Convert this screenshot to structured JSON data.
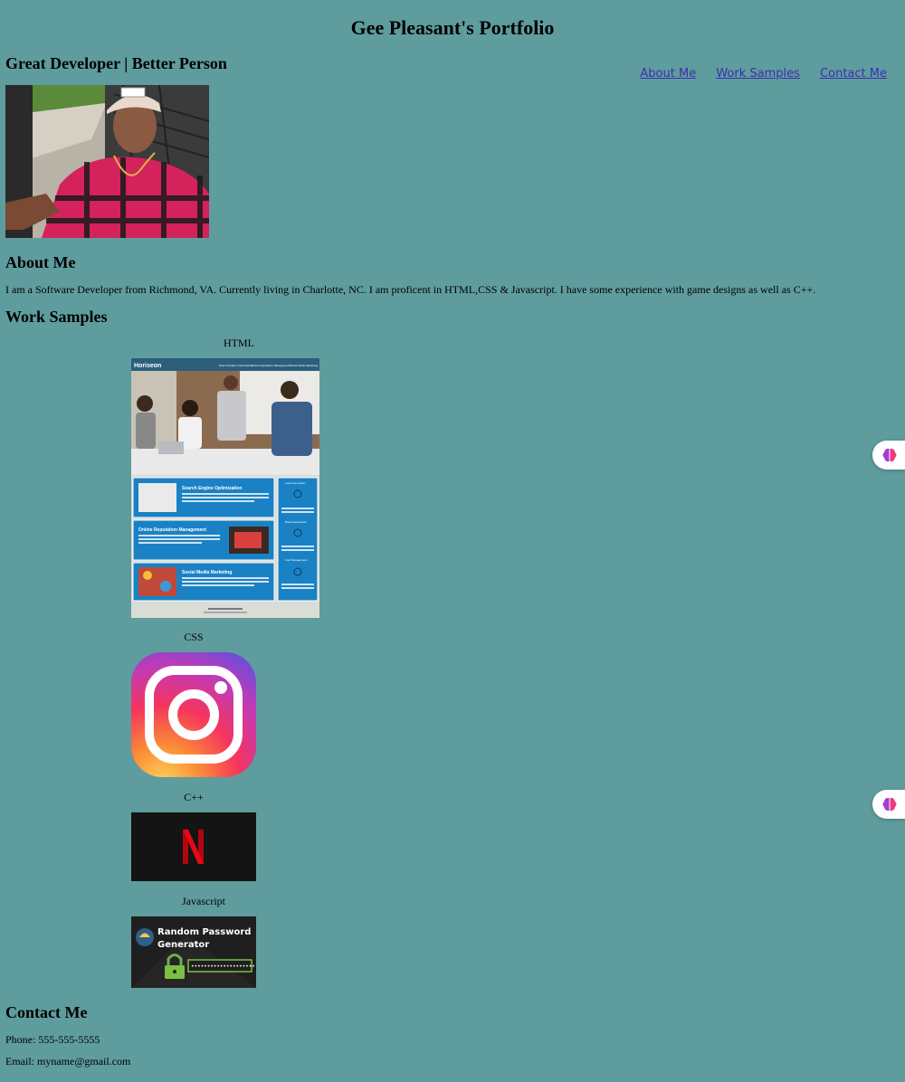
{
  "header": {
    "title": "Gee Pleasant's Portfolio",
    "tagline": "Great Developer | Better Person"
  },
  "nav": {
    "items": [
      "About Me",
      "Work Samples",
      "Contact Me"
    ]
  },
  "about": {
    "heading": "About Me",
    "text": "I am a Software Developer from Richmond, VA. Currently living in Charlotte, NC. I am proficent in HTML,CSS & Javascript. I have some experience with game designs as well as C++."
  },
  "work": {
    "heading": "Work Samples",
    "samples": [
      {
        "label": "HTML",
        "site_name": "Horiseon",
        "nav_links": [
          "Search Engine Optimization",
          "Online Reputation Management",
          "Social Media Marketing"
        ],
        "cards": [
          "Search Engine Optimization",
          "Online Reputation Management",
          "Social Media Marketing"
        ],
        "sidebar": [
          "Lead Generation",
          "Brand Awareness",
          "Cost Management"
        ]
      },
      {
        "label": "CSS",
        "icon": "instagram-icon"
      },
      {
        "label": "C++",
        "icon": "netflix-icon",
        "logo_letter": "N"
      },
      {
        "label": "Javascript",
        "title_line1": "Random Password",
        "title_line2": "Generator",
        "password": "••••••••••••••••••••"
      }
    ]
  },
  "contact": {
    "heading": "Contact Me",
    "phone": "Phone: 555-555-5555",
    "email": "Email: myname@gmail.com"
  },
  "colors": {
    "background": "#5f9c9e",
    "link": "#3b2fb0",
    "netflix_red": "#d81f26",
    "horiseon_blue": "#1a82c4"
  }
}
